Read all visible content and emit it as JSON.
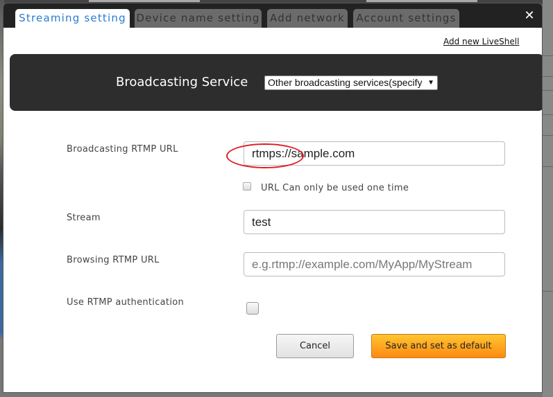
{
  "tabs": [
    {
      "label": "Streaming setting",
      "active": true
    },
    {
      "label": "Device name setting",
      "active": false
    },
    {
      "label": "Add network",
      "active": false
    },
    {
      "label": "Account settings",
      "active": false
    }
  ],
  "close_icon": "✕",
  "add_link": "Add new LiveShell",
  "service": {
    "label": "Broadcasting Service",
    "selected": "Other broadcasting services(specify",
    "arrow": "▼"
  },
  "fields": {
    "rtmp_url": {
      "label": "Broadcasting RTMP URL",
      "value": "rtmps://sample.com"
    },
    "one_time": {
      "label": "URL Can only be used one time",
      "checked": false
    },
    "stream": {
      "label": "Stream",
      "value": "test"
    },
    "browsing_url": {
      "label": "Browsing RTMP URL",
      "value": "",
      "placeholder": "e.g.rtmp://example.com/MyApp/MyStream"
    },
    "auth": {
      "label": "Use RTMP authentication",
      "checked": false
    }
  },
  "buttons": {
    "cancel": "Cancel",
    "save": "Save and set as default"
  },
  "colors": {
    "active_tab_text": "#2a7ad0",
    "save_button": "#ffa820",
    "annotation": "#e01b24"
  }
}
